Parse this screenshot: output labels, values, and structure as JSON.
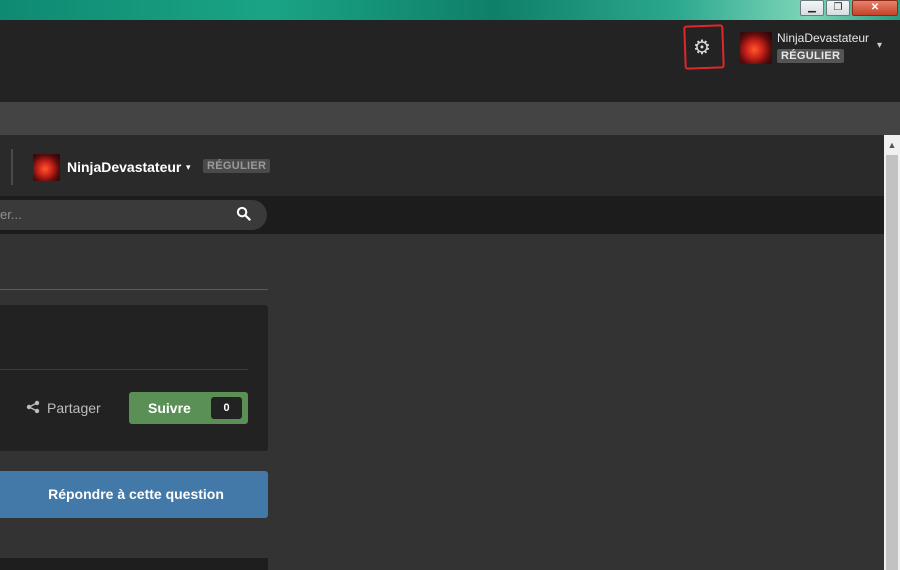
{
  "window": {
    "minimize_glyph": "▁",
    "restore_glyph": "❐",
    "close_glyph": "✕"
  },
  "header": {
    "settings_icon": "gear-icon",
    "user": {
      "name": "NinjaDevastateur",
      "rank": "RÉGULIER",
      "caret": "▾"
    }
  },
  "profile_bar": {
    "user": {
      "name": "NinjaDevastateur",
      "caret": "▾",
      "rank": "RÉGULIER"
    }
  },
  "search": {
    "placeholder": "er...",
    "icon": "search-icon"
  },
  "topic_actions": {
    "share_label": "Partager",
    "follow_label": "Suivre",
    "follow_count": "0"
  },
  "reply": {
    "label": "Répondre à cette question"
  },
  "colors": {
    "follow_green": "#5a8f55",
    "reply_blue": "#4379a8",
    "highlight_red": "#e0262a"
  }
}
